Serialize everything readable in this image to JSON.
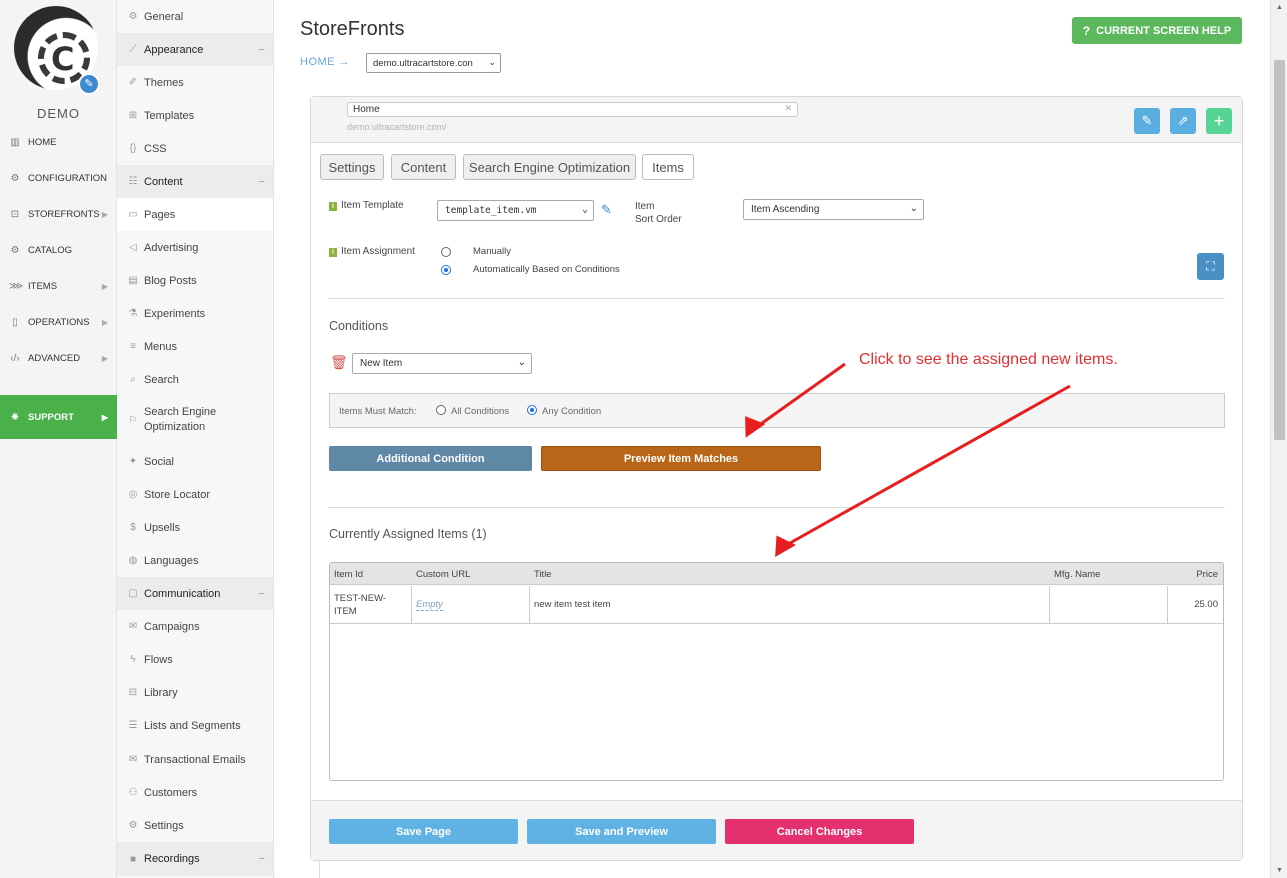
{
  "brand": {
    "store_label": "DEMO"
  },
  "left_nav": [
    {
      "label": "HOME",
      "icon": "chart-icon"
    },
    {
      "label": "CONFIGURATION",
      "icon": "gear-icon"
    },
    {
      "label": "STOREFRONTS",
      "icon": "cart-icon"
    },
    {
      "label": "CATALOG",
      "icon": "gear-icon"
    },
    {
      "label": "ITEMS",
      "icon": "tags-icon"
    },
    {
      "label": "OPERATIONS",
      "icon": "clipboard-icon"
    },
    {
      "label": "ADVANCED",
      "icon": "code-icon"
    },
    {
      "label": "SUPPORT",
      "icon": "bug-icon"
    }
  ],
  "sub_nav": [
    {
      "label": "General"
    },
    {
      "label": "Appearance",
      "group": true
    },
    {
      "label": "Themes"
    },
    {
      "label": "Templates"
    },
    {
      "label": "CSS"
    },
    {
      "label": "Content",
      "group": true
    },
    {
      "label": "Pages",
      "selected": true
    },
    {
      "label": "Advertising"
    },
    {
      "label": "Blog Posts"
    },
    {
      "label": "Experiments"
    },
    {
      "label": "Menus"
    },
    {
      "label": "Search"
    },
    {
      "label": "Search Engine Optimization"
    },
    {
      "label": "Social"
    },
    {
      "label": "Store Locator"
    },
    {
      "label": "Upsells"
    },
    {
      "label": "Languages"
    },
    {
      "label": "Communication",
      "group": true
    },
    {
      "label": "Campaigns"
    },
    {
      "label": "Flows"
    },
    {
      "label": "Library"
    },
    {
      "label": "Lists and Segments"
    },
    {
      "label": "Transactional Emails"
    },
    {
      "label": "Customers"
    },
    {
      "label": "Settings"
    },
    {
      "label": "Recordings",
      "group": true
    }
  ],
  "header": {
    "title": "StoreFronts",
    "breadcrumb_home": "HOME →",
    "store_select": "demo.ultracartstore.con",
    "help_button": "CURRENT SCREEN HELP",
    "help_icon": "?"
  },
  "page": {
    "name": "Home",
    "url": "demo.ultracartstore.com/"
  },
  "tabs": [
    {
      "label": "Settings"
    },
    {
      "label": "Content"
    },
    {
      "label": "Search Engine Optimization"
    },
    {
      "label": "Items",
      "active": true
    }
  ],
  "items_tab": {
    "template_label": "Item Template",
    "template_value": "template_item.vm",
    "sort_label_1": "Item",
    "sort_label_2": "Sort Order",
    "sort_value": "Item Ascending",
    "assignment_label": "Item Assignment",
    "assignment_manual": "Manually",
    "assignment_auto": "Automatically Based on Conditions",
    "assignment_selected": "auto"
  },
  "conditions": {
    "title": "Conditions",
    "condition_value": "New Item",
    "match_label": "Items Must Match:",
    "match_all": "All Conditions",
    "match_any": "Any Condition",
    "match_selected": "any",
    "additional_button": "Additional Condition",
    "preview_button": "Preview Item Matches"
  },
  "assigned": {
    "title": "Currently Assigned Items (1)",
    "columns": [
      "Item Id",
      "Custom URL",
      "Title",
      "Mfg. Name",
      "Price"
    ],
    "rows": [
      {
        "item_id_1": "TEST-NEW-",
        "item_id_2": "ITEM",
        "custom_url": "Empty",
        "title": "new item test item",
        "mfg_name": "",
        "price": "25.00"
      }
    ]
  },
  "footer": {
    "save_button": "Save Page",
    "save_preview_button": "Save and Preview",
    "cancel_button": "Cancel Changes"
  },
  "annotation": {
    "text": "Click to see the assigned new items."
  },
  "colors": {
    "support_green": "#4ab04a",
    "help_green": "#5cb85c",
    "additional_button": "#5f88a6",
    "preview_button": "#b96618",
    "save_button": "#5fb2e3",
    "cancel_button": "#e5306f",
    "annotation_red": "#e03030"
  }
}
